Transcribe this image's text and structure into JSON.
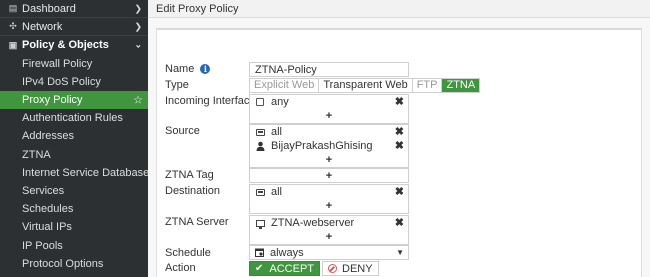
{
  "sidebar": {
    "items": [
      {
        "label": "Dashboard",
        "kind": "top",
        "icon": "dashboard-icon"
      },
      {
        "label": "Network",
        "kind": "top",
        "icon": "network-icon"
      },
      {
        "label": "Policy & Objects",
        "kind": "group",
        "icon": "policy-icon"
      },
      {
        "label": "Firewall Policy",
        "kind": "sub"
      },
      {
        "label": "IPv4 DoS Policy",
        "kind": "sub"
      },
      {
        "label": "Proxy Policy",
        "kind": "active"
      },
      {
        "label": "Authentication Rules",
        "kind": "sub"
      },
      {
        "label": "Addresses",
        "kind": "sub"
      },
      {
        "label": "ZTNA",
        "kind": "sub"
      },
      {
        "label": "Internet Service Database",
        "kind": "sub"
      },
      {
        "label": "Services",
        "kind": "sub"
      },
      {
        "label": "Schedules",
        "kind": "sub"
      },
      {
        "label": "Virtual IPs",
        "kind": "sub"
      },
      {
        "label": "IP Pools",
        "kind": "sub"
      },
      {
        "label": "Protocol Options",
        "kind": "sub"
      }
    ]
  },
  "header": {
    "title": "Edit Proxy Policy"
  },
  "form": {
    "name_label": "Name",
    "name_value": "ZTNA-Policy",
    "type_label": "Type",
    "type_options": [
      "Explicit Web",
      "Transparent Web",
      "FTP",
      "ZTNA"
    ],
    "type_selected": "ZTNA",
    "incoming_label": "Incoming Interface",
    "incoming_value": "any",
    "source_label": "Source",
    "source_values": [
      "all",
      "BijayPrakashGhising"
    ],
    "ztna_tag_label": "ZTNA Tag",
    "destination_label": "Destination",
    "destination_value": "all",
    "ztna_server_label": "ZTNA Server",
    "ztna_server_value": "ZTNA-webserver",
    "schedule_label": "Schedule",
    "schedule_value": "always",
    "action_label": "Action",
    "accept_label": "ACCEPT",
    "deny_label": "DENY",
    "add_symbol": "+",
    "remove_symbol": "✖",
    "info_symbol": "i"
  },
  "colors": {
    "accent": "#40963f",
    "sidebar_bg": "#2d3033",
    "deny_red": "#d9534f"
  }
}
